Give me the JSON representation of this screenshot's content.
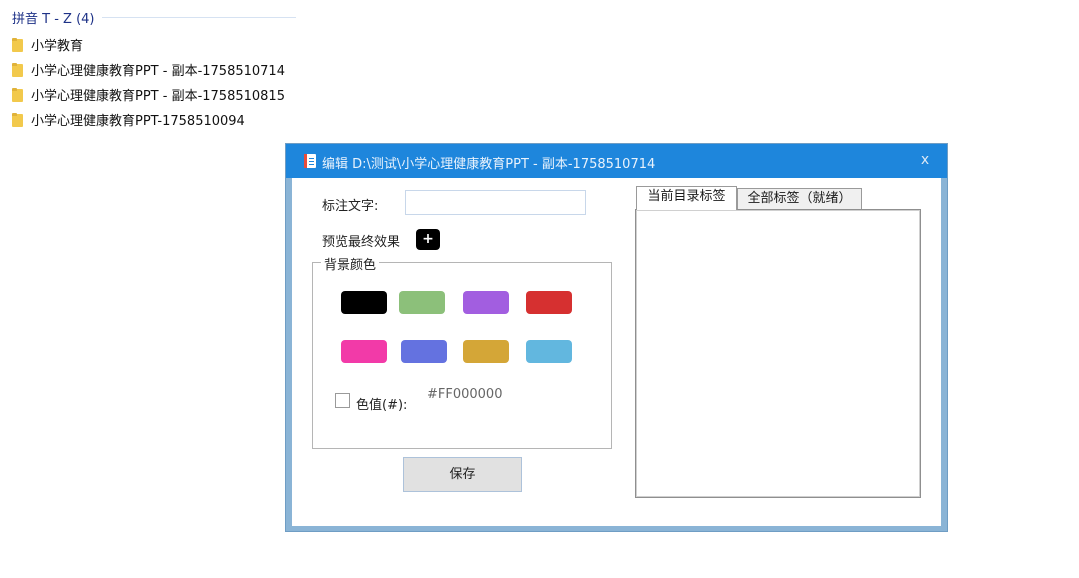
{
  "explorer": {
    "group_header": "拼音 T - Z (4)",
    "items": [
      {
        "name": "小学教育",
        "icon": "folder-icon"
      },
      {
        "name": "小学心理健康教育PPT - 副本-1758510714",
        "icon": "folder-icon"
      },
      {
        "name": "小学心理健康教育PPT - 副本-1758510815",
        "icon": "folder-icon"
      },
      {
        "name": "小学心理健康教育PPT-1758510094",
        "icon": "folder-icon"
      }
    ]
  },
  "dialog": {
    "title": "编辑 D:\\测试\\小学心理健康教育PPT - 副本-1758510714",
    "close_label": "x",
    "label_text_caption": "标注文字:",
    "label_text_value": "",
    "preview_caption": "预览最终效果",
    "preview_badge": "+",
    "bg_color_group": "背景颜色",
    "swatches": [
      {
        "name": "black",
        "color": "#000000"
      },
      {
        "name": "green",
        "color": "#8cc07a"
      },
      {
        "name": "purple",
        "color": "#a25ee0"
      },
      {
        "name": "red",
        "color": "#d63030"
      },
      {
        "name": "pink",
        "color": "#f23aa8"
      },
      {
        "name": "blue",
        "color": "#6472e0"
      },
      {
        "name": "gold",
        "color": "#d4a637"
      },
      {
        "name": "sky",
        "color": "#62b7df"
      }
    ],
    "custom_color_caption": "色值(#):",
    "custom_color_value": "#FF000000",
    "save_label": "保存",
    "tabs": [
      {
        "label": "当前目录标签",
        "active": true
      },
      {
        "label": "全部标签（就绪）",
        "active": false
      }
    ]
  },
  "colors": {
    "titlebar": "#1e86dc",
    "dialog_frame": "#8ab4d6"
  }
}
